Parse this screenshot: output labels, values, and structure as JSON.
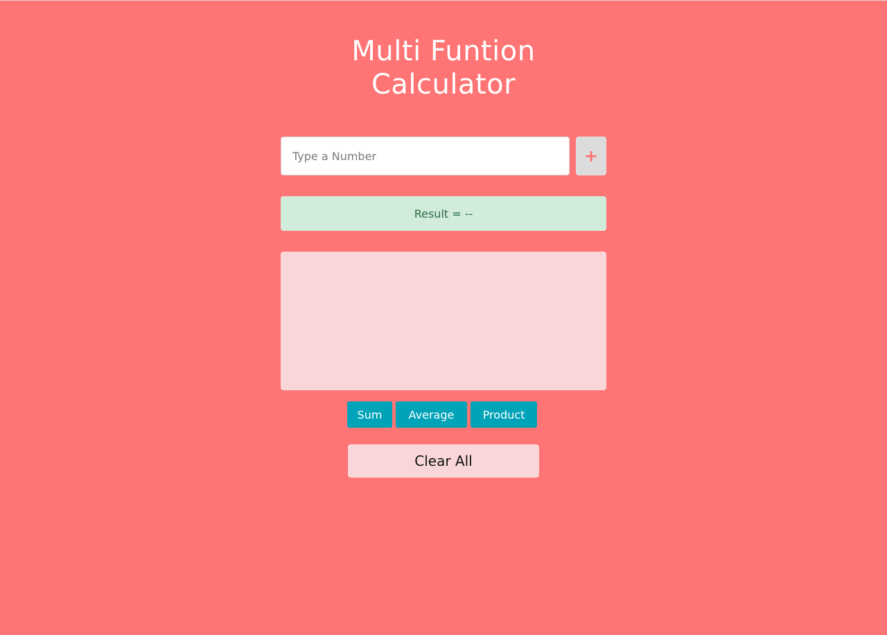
{
  "app": {
    "title_line1": "Multi Funtion",
    "title_line2": "Calculator"
  },
  "input": {
    "placeholder": "Type a Number",
    "value": ""
  },
  "add_button": {
    "label": "+",
    "icon": "plus-icon"
  },
  "result": {
    "text": "Result = --"
  },
  "numbers_list": [],
  "operations": {
    "sum_label": "Sum",
    "average_label": "Average",
    "product_label": "Product"
  },
  "clear_button": {
    "label": "Clear All"
  },
  "colors": {
    "background": "#ff7474",
    "accent": "#00a3b8",
    "result_bg": "#d1ecdb",
    "result_text": "#2f6b45",
    "list_bg": "#f9d7d9"
  }
}
